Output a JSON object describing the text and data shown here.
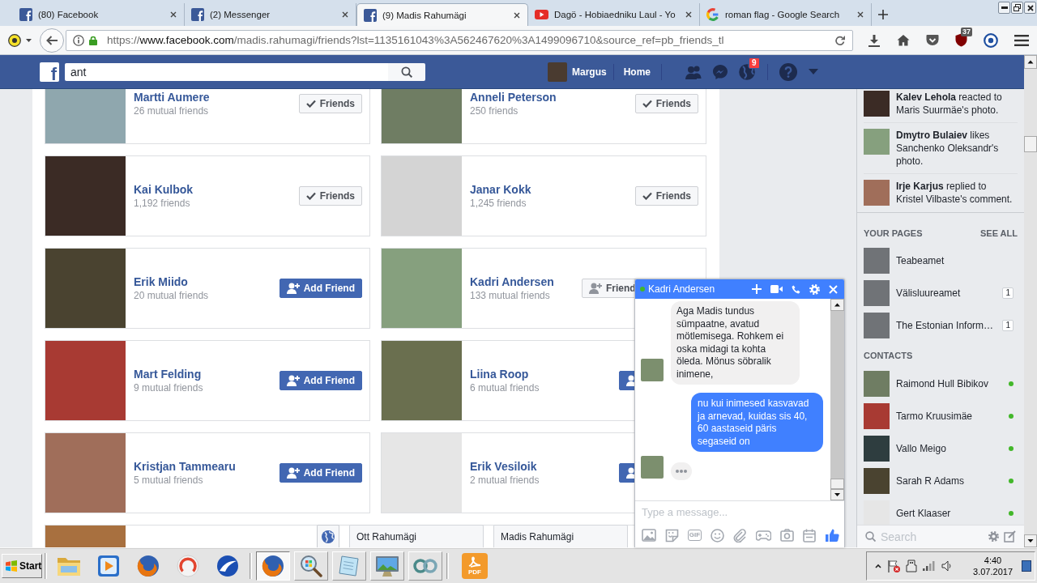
{
  "browser": {
    "tabs": [
      {
        "kind": "facebook",
        "title": "(80) Facebook",
        "selected": false
      },
      {
        "kind": "facebook",
        "title": "(2) Messenger",
        "selected": false
      },
      {
        "kind": "facebook",
        "title": "(9) Madis Rahumägi",
        "selected": true
      },
      {
        "kind": "youtube",
        "title": "Dagö - Hobiaedniku Laul - Yo",
        "selected": false
      },
      {
        "kind": "google",
        "title": "roman flag - Google Search",
        "selected": false
      }
    ],
    "url": "https://**www.facebook.com**/madis.rahumagi/friends?lst=1135161043%3A562467620%3A1499096710&source_ref=pb_friends_tl",
    "extension_badge": "37"
  },
  "facebook_header": {
    "logo": "f",
    "search": {
      "value": "ant"
    },
    "user": "Margus",
    "home": "Home",
    "notifications_badge": "9"
  },
  "friends": [
    {
      "kind": "friend",
      "name": "Martti Aumere",
      "subtitle": "26 mutual friends",
      "button": {
        "kind": "friends",
        "label": "Friends"
      }
    },
    {
      "kind": "friend",
      "name": "Anneli Peterson",
      "subtitle": "250 friends",
      "button": {
        "kind": "friends",
        "label": "Friends"
      }
    },
    {
      "kind": "friend",
      "name": "Kai Kulbok",
      "subtitle": "1,192 friends",
      "button": {
        "kind": "friends",
        "label": "Friends"
      }
    },
    {
      "kind": "friend",
      "name": "Janar Kokk",
      "subtitle": "1,245 friends",
      "button": {
        "kind": "friends",
        "label": "Friends"
      }
    },
    {
      "kind": "friend",
      "name": "Erik Miido",
      "subtitle": "20 mutual friends",
      "button": {
        "kind": "add",
        "label": "Add Friend"
      }
    },
    {
      "kind": "friend",
      "name": "Kadri Andersen",
      "subtitle": "133 mutual friends",
      "button": {
        "kind": "request",
        "label": "Friend"
      }
    },
    {
      "kind": "friend",
      "name": "Mart Felding",
      "subtitle": "9 mutual friends",
      "button": {
        "kind": "add",
        "label": "Add Friend"
      }
    },
    {
      "kind": "friend",
      "name": "Liina Roop",
      "subtitle": "6 mutual friends",
      "button": {
        "kind": "add"
      }
    },
    {
      "kind": "friend",
      "name": "Kristjan Tammearu",
      "subtitle": "5 mutual friends",
      "button": {
        "kind": "add",
        "label": "Add Friend"
      }
    },
    {
      "kind": "friend",
      "name": "Erik Vesiloik",
      "subtitle": "2 mutual friends",
      "button": {
        "kind": "add"
      }
    },
    {
      "kind": "cut_off"
    },
    {
      "kind": "cut_off"
    }
  ],
  "sidebar": {
    "ticker": [
      {
        "text": "**Kalev Lehola** reacted to Maris Suurmäe's photo."
      },
      {
        "text": "**Dmytro Bulaiev** likes Sanchenko Oleksandr's photo."
      },
      {
        "text": "**Irje Karjus** replied to Kristel Vilbaste's comment."
      }
    ],
    "pages": {
      "title": "YOUR PAGES",
      "see_all": "SEE ALL",
      "items": [
        {
          "name": "Teabeamet"
        },
        {
          "name": "Välisluureamet",
          "badge": "1"
        },
        {
          "name": "The Estonian Inform…",
          "badge": "1"
        }
      ]
    },
    "contacts": {
      "title": "CONTACTS",
      "items": [
        {
          "name": "Raimond Hull Bibikov",
          "online": true
        },
        {
          "name": "Tarmo Kruusimäe",
          "online": true
        },
        {
          "name": "Vallo Meigo",
          "online": true
        },
        {
          "name": "Sarah R Adams",
          "online": true
        },
        {
          "name": "Gert Klaaser",
          "online": true
        }
      ]
    },
    "search": {
      "placeholder": "Search"
    }
  },
  "chat": {
    "name": "Kadri Andersen",
    "online": true,
    "messages": [
      {
        "kind": "received",
        "text": "Aga Madis tundus sümpaatne, avatud mötlemisega. Rohkem ei oska midagi ta kohta öleda. Mönus söbralik inimene,"
      },
      {
        "kind": "sent",
        "text": "nu kui inimesed kasvavad ja arnevad, kuidas sis 40, 60 aastaseid päris segaseid on"
      }
    ],
    "typing": true,
    "composer": {
      "placeholder": "Type a message...",
      "gif": "GIF"
    }
  },
  "chat_tabs": [
    {
      "name": "Ott Rahumägi"
    },
    {
      "name": "Madis Rahumägi"
    }
  ],
  "taskbar": {
    "start": "Start",
    "quick_launch": [
      {
        "kind": "folder"
      },
      {
        "kind": "media"
      },
      {
        "kind": "firefox"
      },
      {
        "kind": "ring"
      },
      {
        "kind": "swoosh"
      }
    ],
    "windows": [
      {
        "kind": "firefox",
        "selected": true
      },
      {
        "kind": "magnifier",
        "selected": false
      },
      {
        "kind": "notepad",
        "selected": false
      },
      {
        "kind": "monitor",
        "selected": false
      },
      {
        "kind": "rings",
        "selected": false
      }
    ],
    "shortcuts": [
      {
        "kind": "pdf",
        "label": "PDF"
      }
    ],
    "clock": {
      "time": "4:40",
      "date": "3.07.2017"
    }
  }
}
